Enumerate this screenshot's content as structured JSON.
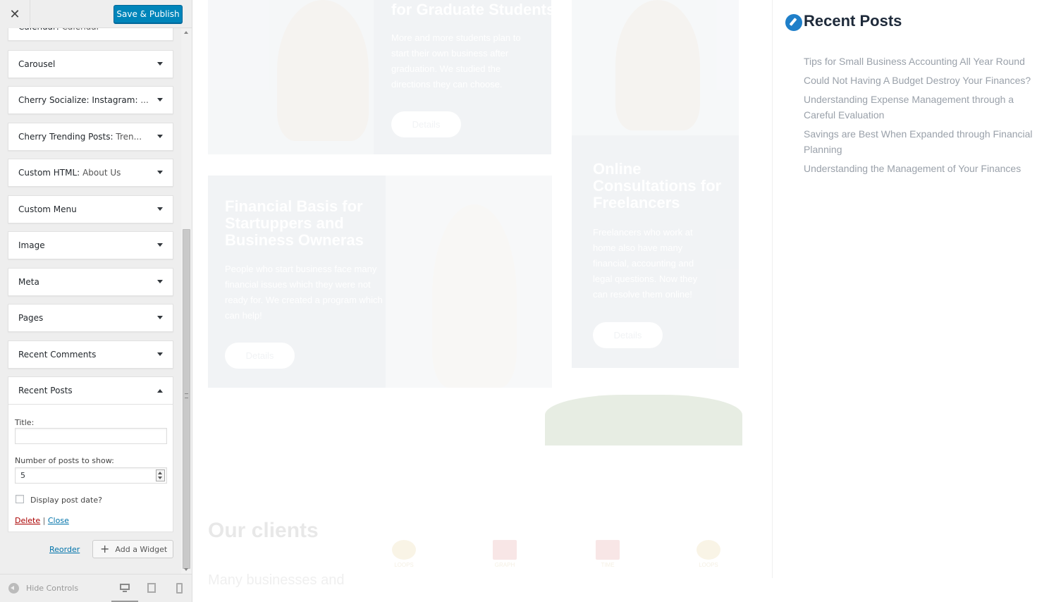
{
  "header": {
    "close_icon": "close-icon",
    "save_label": "Save & Publish"
  },
  "widgets": [
    {
      "name": "Calendar:",
      "sub": "Calendar"
    },
    {
      "name": "Carousel",
      "sub": ""
    },
    {
      "name": "Cherry Socialize: Instagram:",
      "sub": "..."
    },
    {
      "name": "Cherry Trending Posts:",
      "sub": "Tren..."
    },
    {
      "name": "Custom HTML:",
      "sub": "About Us"
    },
    {
      "name": "Custom Menu",
      "sub": ""
    },
    {
      "name": "Image",
      "sub": ""
    },
    {
      "name": "Meta",
      "sub": ""
    },
    {
      "name": "Pages",
      "sub": ""
    },
    {
      "name": "Recent Comments",
      "sub": ""
    }
  ],
  "recent_posts_widget": {
    "name": "Recent Posts",
    "title_label": "Title:",
    "title_value": "",
    "number_label": "Number of posts to show:",
    "number_value": "5",
    "display_date_label": "Display post date?",
    "display_date_checked": false,
    "delete_label": "Delete",
    "separator": "|",
    "close_label": "Close"
  },
  "footer_actions": {
    "reorder_label": "Reorder",
    "add_widget_label": "Add a Widget"
  },
  "footer": {
    "hide_controls_label": "Hide Controls",
    "devices": [
      "desktop",
      "tablet",
      "mobile"
    ],
    "active_device": "desktop"
  },
  "preview": {
    "cards": [
      {
        "title": "for Graduate Students",
        "text": "More and more students plan to start their own business after graduation. We studied the directions they can choose.",
        "button": "Details"
      },
      {
        "title": "Financial Basis for Startuppers and Business Owneras",
        "text": "People who start business face many financial issues which they were not ready for. We created a program which can help!",
        "button": "Details"
      },
      {
        "title": "Online Consultations for Freelancers",
        "text": "Freelancers who work at home also have many financial, accounting and legal questions. Now they can resolve them online!",
        "button": "Details"
      }
    ],
    "clients_title": "Our clients",
    "clients_text": "Many businesses and",
    "client_logos": [
      "LOOPS",
      "GRAPH",
      "TIME",
      "LOOPS"
    ],
    "sidebar": {
      "heading": "Recent Posts",
      "posts": [
        "Tips for Small Business Accounting All Year Round",
        "Could Not Having A Budget Destroy Your Finances?",
        "Understanding Expense Management through a Careful Evaluation",
        "Savings are Best When Expanded through Financial Planning",
        "Understanding the Management of Your Finances"
      ]
    }
  },
  "colors": {
    "primary_button": "#0085ba",
    "link": "#0073aa",
    "delete": "#a00000",
    "accent_icon": "#1f7fc9"
  }
}
